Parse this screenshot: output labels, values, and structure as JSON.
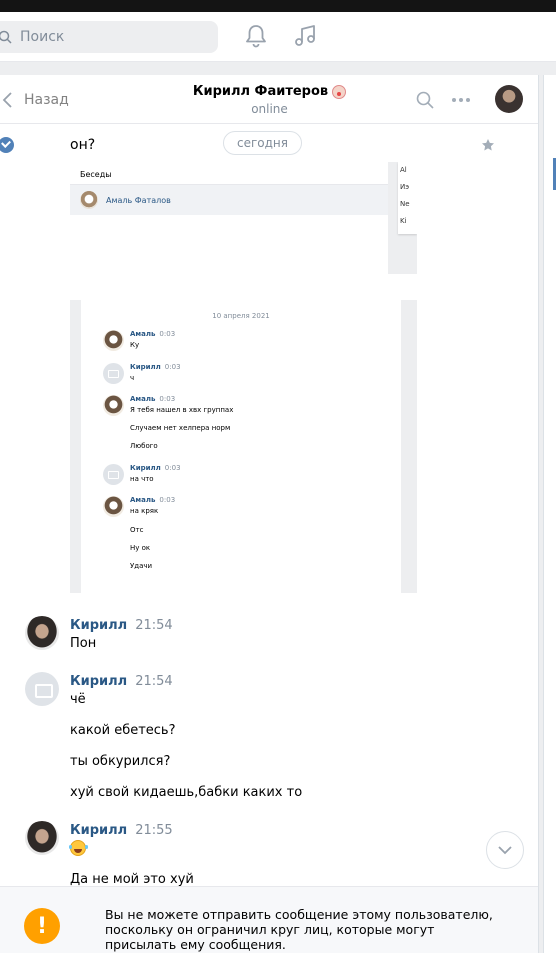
{
  "header": {
    "search_placeholder": "Поиск"
  },
  "chat": {
    "back_label": "Назад",
    "peer_name": "Кирилл Фаитеров",
    "peer_status": "online",
    "date_pill": "сегодня"
  },
  "top_message": "он?",
  "shot1": {
    "title": "Беседы",
    "row_name": "Амаль Фаталов",
    "card_items": [
      "Al",
      "Иэ",
      "Ne",
      "Ki"
    ]
  },
  "shot2": {
    "date": "10 апреля 2021",
    "messages": [
      {
        "name": "Амаль",
        "time": "0:03",
        "lines": [
          "Ку"
        ]
      },
      {
        "name": "Кирилл",
        "time": "0:03",
        "lines": [
          "ч"
        ]
      },
      {
        "name": "Амаль",
        "time": "0:03",
        "lines": [
          "Я тебя нашел в хвх группах",
          "Случаем нет хелпера норм",
          "Любого"
        ]
      },
      {
        "name": "Кирилл",
        "time": "0:03",
        "lines": [
          "на что"
        ]
      },
      {
        "name": "Амаль",
        "time": "0:03",
        "lines": [
          "на кряк",
          "Отс",
          "Ну ок",
          "Удачи"
        ]
      }
    ]
  },
  "messages": [
    {
      "name": "Кирилл",
      "time": "21:54",
      "lines": [
        "Пон"
      ]
    },
    {
      "name": "Кирилл",
      "time": "21:54",
      "lines": [
        "чё",
        "какой ебетесь?",
        "ты обкурился?",
        "хуй свой кидаешь,бабки каких то"
      ]
    },
    {
      "name": "Кирилл",
      "time": "21:55",
      "lines": [
        "Да не мой это хуй"
      ]
    }
  ],
  "footer": {
    "warning": "Вы не можете отправить сообщение этому пользователю, поскольку он ограничил круг лиц, которые могут присылать ему сообщения.",
    "warning_symbol": "!"
  },
  "colors": {
    "accent": "#5181b8",
    "link": "#2a5885",
    "warning": "#ffa000"
  }
}
